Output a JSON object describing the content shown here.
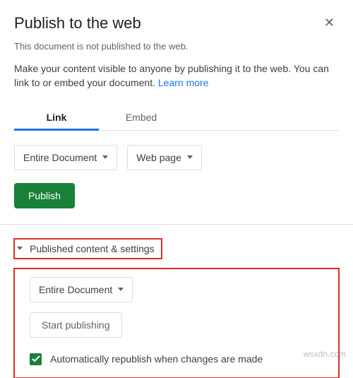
{
  "header": {
    "title": "Publish to the web"
  },
  "status": "This document is not published to the web.",
  "description_a": "Make your content visible to anyone by publishing it to the web. You can link to or embed your document. ",
  "learn_more": "Learn more",
  "tabs": {
    "link": "Link",
    "embed": "Embed"
  },
  "scope_dropdown": "Entire Document",
  "format_dropdown": "Web page",
  "publish_button": "Publish",
  "disclosure_label": "Published content & settings",
  "settings": {
    "scope_dropdown": "Entire Document",
    "start_button": "Start publishing",
    "auto_republish": "Automatically republish when changes are made"
  },
  "watermark": "wsxdn.com"
}
